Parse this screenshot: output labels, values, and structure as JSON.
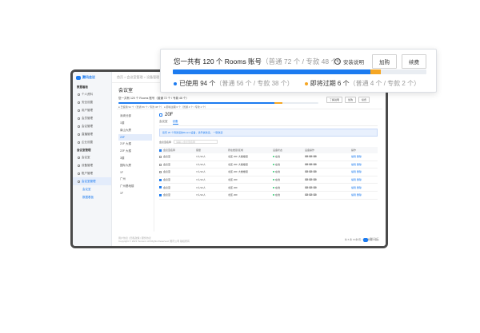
{
  "colors": {
    "primary": "#1c7bf0",
    "warning": "#f5a623",
    "success": "#2ecc71",
    "frame": "#4a4a4a"
  },
  "brand": {
    "name": "腾讯会议",
    "sub": "腾讯会议"
  },
  "topbar": {
    "breadcrumb": "首页 > 会议室管理 > 设备管理 > 会议室"
  },
  "sidebar": {
    "groups": [
      {
        "label": "数据看板",
        "items": [
          "个人资料",
          "安全设置",
          "用户管理",
          "会员管理",
          "会议管理",
          "直播管理",
          "企业设置"
        ]
      },
      {
        "label": "会议室管理",
        "items": [
          "会议室",
          "设备管理",
          "账户管理"
        ]
      },
      {
        "label": "会议室管理",
        "items": [
          "会议室管理"
        ]
      }
    ],
    "subitems": [
      "会议室",
      "数据看板"
    ]
  },
  "page": {
    "title": "会议室"
  },
  "summary": {
    "used_fraction": 0.78,
    "expiring_fraction": 0.04,
    "mini_title": "您一共有 120 个 Rooms 账号（普通 72 个 / 专款 48 个）",
    "mini_legend": "● 已使用 94 个（普通 56 个 / 专款 38 个）   ● 即将过期 6 个（普通 4 个 / 专款 2 个）",
    "mini_actions": [
      "了解说明",
      "加购",
      "续费"
    ]
  },
  "callout": {
    "title_main": "您一共有 120 个 Rooms 账号",
    "title_detail": "（普通 72 个 / 专款 48 个）",
    "info_label": "安装说明",
    "buy_label": "加购",
    "renew_label": "续费",
    "used_label": "已使用 94 个",
    "used_detail": "（普通 56 个 / 专款 38 个）",
    "expiring_label": "即将过期 6 个",
    "expiring_detail": "（普通 4 个 / 专款 2 个）"
  },
  "tree": [
    "深圳分部",
    "1楼",
    "南山大厦",
    "20F",
    "21F 大楼",
    "22F 大楼",
    "3楼",
    "国际大厦",
    "1F",
    "广州",
    "广州基地楼",
    "1F"
  ],
  "panel": {
    "floor": "20F",
    "tabs": [
      "会议室",
      "设备"
    ],
    "notice": "您有 20 个待激活的Rooms设备，请尽快激活。  一键激活",
    "search_label": "会议室名称",
    "search_placeholder": "请输入会议室名称",
    "columns": [
      "会议室名称",
      "容量",
      "所在楼层/区域",
      "设备状态",
      "设备操作",
      "操作"
    ],
    "rows": [
      {
        "name": "会议室",
        "cap": "7人/12人",
        "loc": "北区 20F 大楼楼层",
        "status": "在线",
        "ops": "编辑  删除"
      },
      {
        "name": "会议室",
        "cap": "7人/12人",
        "loc": "北区 20F 大楼楼层",
        "status": "在线",
        "ops": "编辑  删除"
      },
      {
        "name": "会议室",
        "cap": "7人/12人",
        "loc": "北区 20F 大楼楼层",
        "status": "在线",
        "ops": "编辑  删除"
      },
      {
        "name": "会议室",
        "cap": "7人/12人",
        "loc": "北区 20F",
        "status": "在线",
        "ops": "编辑  删除"
      },
      {
        "name": "会议室",
        "cap": "7人/12人",
        "loc": "北区 20F",
        "status": "在线",
        "ops": "编辑  删除"
      },
      {
        "name": "会议室",
        "cap": "7人/12人",
        "loc": "北区 20F",
        "status": "在线",
        "ops": "编辑  删除"
      }
    ],
    "pager": "共 6 条   10条/页   < 1 >   前往 1 页"
  },
  "footer": {
    "line1": "用户协议 | 隐私政策 | 服务协议",
    "line2": "Copyright © 2021 Tencent. All Rights Reserved. 腾讯公司 版权所有",
    "logo": "腾讯云"
  }
}
